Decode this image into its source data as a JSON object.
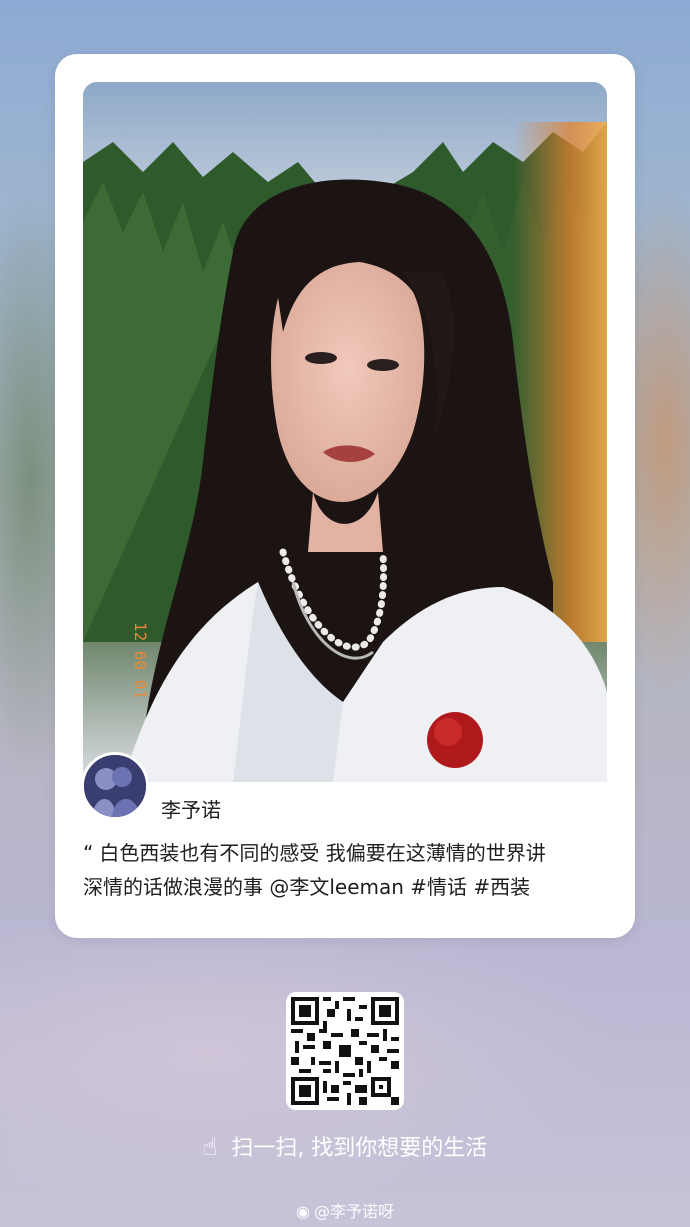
{
  "card": {
    "username": "李予诺",
    "quote_mark": "“",
    "text_line1": "白色西装也有不同的感受 我偏要在这薄情的世界讲",
    "text_line2": "深情的话做浪漫的事 @李文leeman #情话  #西装",
    "photo_stamp": "12 60 01"
  },
  "footer": {
    "hand_icon": "pointing-hand-icon",
    "scan_text": "扫一扫, 找到你想要的生活",
    "watermark_icon": "weibo-icon",
    "watermark_text": "@李予诺呀"
  },
  "colors": {
    "card_bg": "#ffffff",
    "text": "#1e1e1e",
    "footer_text": "#ffffff"
  }
}
